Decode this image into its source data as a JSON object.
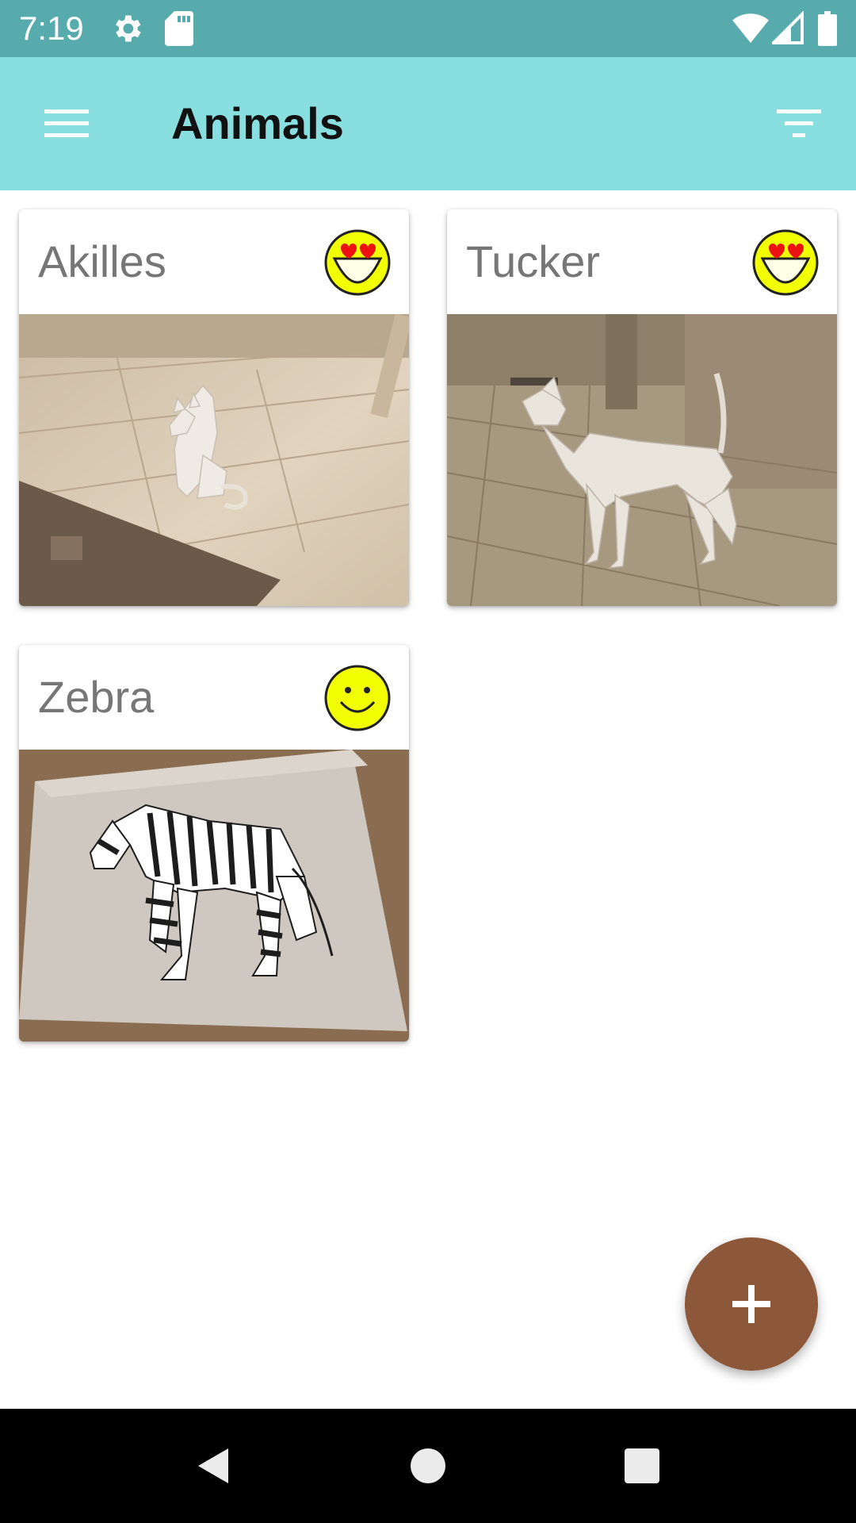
{
  "status_bar": {
    "time": "7:19",
    "icons": [
      "gear-icon",
      "sd-card-icon",
      "wifi-icon",
      "signal-icon",
      "battery-icon"
    ]
  },
  "app_bar": {
    "title": "Animals",
    "menu_icon": "hamburger-menu-icon",
    "filter_icon": "filter-icon"
  },
  "cards": [
    {
      "name": "Akilles",
      "mood": "heart-eyes-smiley-icon",
      "photo": "low-poly-cat-figure-on-wooden-floor"
    },
    {
      "name": "Tucker",
      "mood": "heart-eyes-smiley-icon",
      "photo": "low-poly-dog-figure-in-hallway"
    },
    {
      "name": "Zebra",
      "mood": "smiley-face-icon",
      "photo": "low-poly-zebra-figure-on-board"
    }
  ],
  "fab": {
    "icon": "plus-icon"
  },
  "nav": {
    "icons": [
      "back-triangle-icon",
      "home-circle-icon",
      "recents-square-icon"
    ]
  },
  "colors": {
    "status_bar": "#58abac",
    "app_bar": "#89dfdf",
    "fab": "#8d573a",
    "card_text": "#767676",
    "smiley": "#f2ff00"
  }
}
